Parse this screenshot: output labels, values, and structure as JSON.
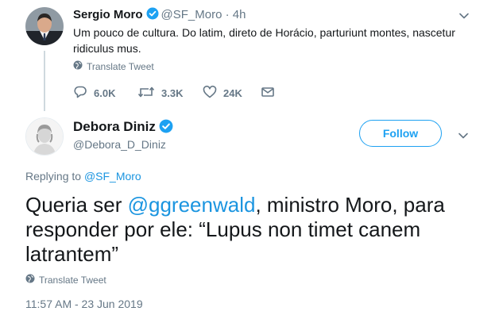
{
  "parent_tweet": {
    "author_name": "Sergio Moro",
    "handle": "@SF_Moro",
    "separator": "·",
    "time": "4h",
    "text": "Um pouco de cultura. Do latim, direto de Horácio, parturiunt montes, nascetur ridiculus mus.",
    "translate_label": "Translate Tweet",
    "reply_count": "6.0K",
    "retweet_count": "3.3K",
    "like_count": "24K"
  },
  "main_tweet": {
    "author_name": "Debora Diniz",
    "handle": "@Debora_D_Diniz",
    "follow_label": "Follow",
    "replying_prefix": "Replying to ",
    "replying_handle": "@SF_Moro",
    "text_before": "Queria ser ",
    "mention": "@ggreenwald",
    "text_after": ", ministro Moro, para responder por ele: “Lupus non timet canem latrantem”",
    "translate_label": "Translate Tweet",
    "timestamp": "11:57 AM - 23 Jun 2019"
  },
  "colors": {
    "accent": "#1da1f2",
    "link": "#1b95e0",
    "muted": "#657786",
    "text": "#14171a"
  }
}
